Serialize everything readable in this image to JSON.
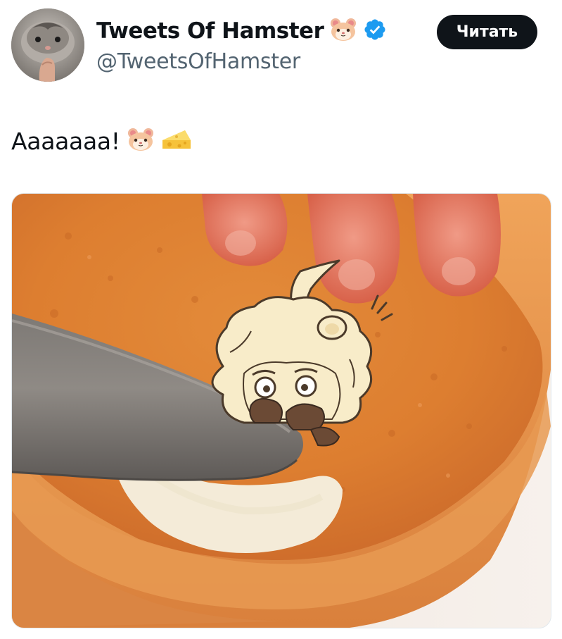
{
  "tweet": {
    "author": {
      "display_name": "Tweets Of Hamster",
      "handle": "@TweetsOfHamster",
      "verified": true,
      "name_emoji": "hamster-face-emoji",
      "avatar": "hamster-photo"
    },
    "follow_button_label": "Читать",
    "text": "Aaaaaaa!",
    "text_emojis": [
      "hamster-face-emoji",
      "cheese-wedge-emoji"
    ],
    "media": {
      "kind": "image",
      "subject": "knife spreading butter on toast with cartoon hamster"
    }
  },
  "colors": {
    "text_primary": "#0f1419",
    "text_secondary": "#536471",
    "follow_button_bg": "#0f1419",
    "follow_button_text": "#ffffff",
    "verified_blue": "#1d9bf0",
    "toast_orange": "#e08a3a"
  },
  "icons": {
    "verified": "verified-badge-icon",
    "hamster": "hamster-face-emoji",
    "cheese": "cheese-wedge-emoji"
  }
}
